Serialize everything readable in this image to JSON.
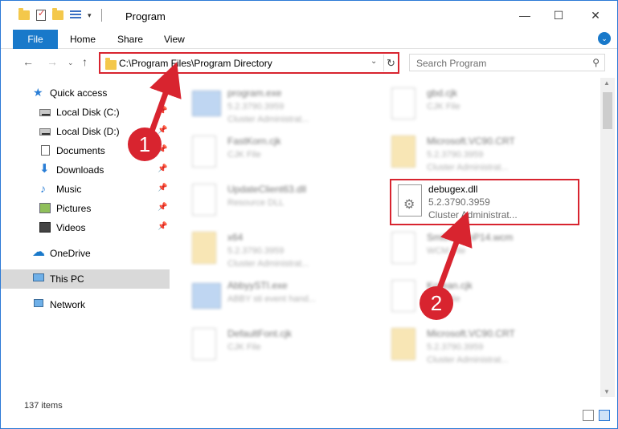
{
  "window": {
    "title": "Program"
  },
  "ribbon": {
    "tabs": [
      "File",
      "Home",
      "Share",
      "View"
    ],
    "expand_icon": "chevron-down-icon"
  },
  "nav": {
    "address": "C:\\Program Files\\Program Directory",
    "search_placeholder": "Search Program"
  },
  "sidebar": {
    "items": [
      {
        "label": "Quick access",
        "icon": "star-icon"
      },
      {
        "label": "Local Disk (C:)",
        "icon": "disk-icon",
        "pinned": true
      },
      {
        "label": "Local Disk (D:)",
        "icon": "disk-icon",
        "pinned": true
      },
      {
        "label": "Documents",
        "icon": "documents-icon",
        "pinned": true
      },
      {
        "label": "Downloads",
        "icon": "downloads-icon",
        "pinned": true
      },
      {
        "label": "Music",
        "icon": "music-icon",
        "pinned": true
      },
      {
        "label": "Pictures",
        "icon": "pictures-icon",
        "pinned": true
      },
      {
        "label": "Videos",
        "icon": "videos-icon",
        "pinned": true
      },
      {
        "label": "OneDrive",
        "icon": "onedrive-icon"
      },
      {
        "label": "This PC",
        "icon": "pc-icon",
        "selected": true
      },
      {
        "label": "Network",
        "icon": "network-icon"
      }
    ]
  },
  "files": {
    "left": [
      {
        "name": "program.exe",
        "line1": "5.2.3790.3959",
        "line2": "Cluster Administrat..."
      },
      {
        "name": "FastKorn.cjk",
        "line1": "CJK File",
        "line2": ""
      },
      {
        "name": "UpdateClient63.dll",
        "line1": "Resource DLL",
        "line2": ""
      },
      {
        "name": "x64",
        "line1": "5.2.3790.3959",
        "line2": "Cluster Administrat..."
      },
      {
        "name": "AbbyySTI.exe",
        "line1": "ABBY sti event hand...",
        "line2": ""
      },
      {
        "name": "DefaultFont.cjk",
        "line1": "CJK File",
        "line2": ""
      }
    ],
    "right": [
      {
        "name": "gbd.cjk",
        "line1": "CJK File",
        "line2": ""
      },
      {
        "name": "Microsoft.VC90.CRT",
        "line1": "5.2.3790.3959",
        "line2": "Cluster Administrat..."
      },
      {
        "name": "SmithScanP14.wcm",
        "line1": "WCM File",
        "line2": ""
      },
      {
        "name": "Korean.cjk",
        "line1": "CJK File",
        "line2": ""
      },
      {
        "name": "Microsoft.VC90.CRT",
        "line1": "5.2.3790.3959",
        "line2": "Cluster Administrat..."
      }
    ],
    "highlighted": {
      "name": "debugex.dll",
      "version": "5.2.3790.3959",
      "company": "Cluster Administrat..."
    }
  },
  "status": {
    "item_count": "137 items"
  },
  "annotations": {
    "step1": "1",
    "step2": "2",
    "color": "#d8242f"
  }
}
